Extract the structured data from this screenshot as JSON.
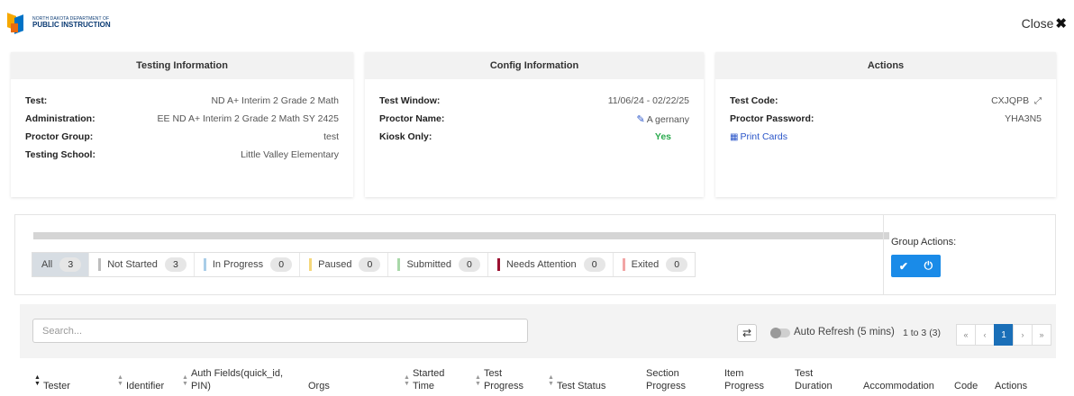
{
  "header": {
    "logo_small": "NORTH DAKOTA DEPARTMENT OF",
    "logo_big": "PUBLIC INSTRUCTION",
    "close_label": "Close",
    "close_icon": "✖"
  },
  "testing_info": {
    "title": "Testing Information",
    "rows": [
      {
        "label": "Test:",
        "value": "ND A+ Interim 2 Grade 2 Math"
      },
      {
        "label": "Administration:",
        "value": "EE ND A+ Interim 2 Grade 2 Math SY 2425"
      },
      {
        "label": "Proctor Group:",
        "value": "test"
      },
      {
        "label": "Testing School:",
        "value": "Little Valley Elementary"
      }
    ]
  },
  "config_info": {
    "title": "Config Information",
    "rows": [
      {
        "label": "Test Window:",
        "value": "11/06/24 - 02/22/25"
      },
      {
        "label": "Proctor Name:",
        "value": "A gernany"
      },
      {
        "label": "Kiosk Only:",
        "value": "Yes"
      }
    ]
  },
  "actions_info": {
    "title": "Actions",
    "rows": [
      {
        "label": "Test Code:",
        "value": "CXJQPB"
      },
      {
        "label": "Proctor Password:",
        "value": "YHA3N5"
      }
    ],
    "print_cards": "Print Cards"
  },
  "filters": [
    {
      "label": "All",
      "count": "3",
      "color": ""
    },
    {
      "label": "Not Started",
      "count": "3",
      "color": "#bdbdbd"
    },
    {
      "label": "In Progress",
      "count": "0",
      "color": "#a9cde8"
    },
    {
      "label": "Paused",
      "count": "0",
      "color": "#f5d77a"
    },
    {
      "label": "Submitted",
      "count": "0",
      "color": "#a8d8a8"
    },
    {
      "label": "Needs Attention",
      "count": "0",
      "color": "#9b1030"
    },
    {
      "label": "Exited",
      "count": "0",
      "color": "#f2a5a5"
    }
  ],
  "group_actions": {
    "label": "Group Actions:"
  },
  "toolbar": {
    "search_placeholder": "Search...",
    "auto_refresh": "Auto Refresh (5 mins)",
    "range": "1 to 3 (3)",
    "pager": [
      "«",
      "‹",
      "1",
      "›",
      "»"
    ]
  },
  "columns": [
    {
      "label": "Tester",
      "sort": true
    },
    {
      "label": "Identifier",
      "sort": true
    },
    {
      "label": "Auth Fields(quick_id, PIN)",
      "sort": true
    },
    {
      "label": "Orgs",
      "sort": false
    },
    {
      "label": "Started Time",
      "sort": true
    },
    {
      "label": "Test Progress",
      "sort": true
    },
    {
      "label": "Test Status",
      "sort": true
    },
    {
      "label": "Section Progress",
      "sort": false
    },
    {
      "label": "Item Progress",
      "sort": false
    },
    {
      "label": "Test Duration",
      "sort": false
    },
    {
      "label": "Accommodation",
      "sort": false
    },
    {
      "label": "Code",
      "sort": false
    },
    {
      "label": "Actions",
      "sort": false
    }
  ]
}
